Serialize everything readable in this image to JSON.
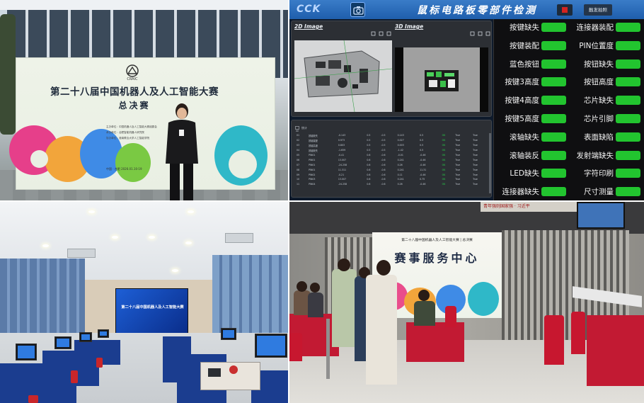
{
  "banner": {
    "brand": "CRAIC",
    "title_line1": "第二十八届中国机器人及人工智能大赛",
    "title_line2": "总决赛",
    "date": "中国 · 合肥    2026.01.10-19",
    "organizers": [
      "主办单位：中国机器人及人工智能大赛组委会",
      "承办单位：合肥智能机器人研究院",
      "协办单位：淮南联合大学人工智能学院"
    ]
  },
  "software": {
    "brand": "CCK",
    "title": "鼠标电路板零部件检测",
    "trigger_button": "触发拍照",
    "panel_2d": "2D Image",
    "panel_3d": "3D Image",
    "table_title": "统计",
    "table_tab": "All",
    "table_rows": [
      [
        "01",
        "按键缺失",
        "-0.143",
        "0.5",
        "-0.5",
        "0.143",
        "0.5",
        "OK",
        "True",
        "True"
      ],
      [
        "02",
        "按键装配",
        "0.973",
        "0.5",
        "-0.5",
        "0.027",
        "0.5",
        "OK",
        "True",
        "True"
      ],
      [
        "03",
        "按键高度",
        "0.803",
        "0.5",
        "-0.5",
        "0.003",
        "0.5",
        "OK",
        "True",
        "True"
      ],
      [
        "04",
        "按键缺失",
        "-1.659",
        "0.5",
        "-0.5",
        "-1.42",
        "0.5",
        "OK",
        "True",
        "True"
      ],
      [
        "05",
        "PIN01",
        "-0.41",
        "0.6",
        "-0.6",
        "-0.01",
        "-0.46",
        "OK",
        "True",
        "True"
      ],
      [
        "06",
        "PIN01",
        "13.007",
        "0.6",
        "-0.6",
        "0.241",
        "-0.46",
        "OK",
        "True",
        "True"
      ],
      [
        "07",
        "PIN01",
        "-24.258",
        "0.6",
        "-0.6",
        "0.26",
        "-0.46",
        "OK",
        "True",
        "True"
      ],
      [
        "08",
        "PIN01",
        "11.311",
        "0.6",
        "-0.6",
        "0.241",
        "11.31",
        "OK",
        "True",
        "True"
      ],
      [
        "09",
        "PIN02",
        "-0.21",
        "0.6",
        "-0.6",
        "0.11",
        "-0.46",
        "OK",
        "True",
        "True"
      ],
      [
        "10",
        "PIN03",
        "13.007",
        "0.6",
        "-0.6",
        "0.241",
        "0.75",
        "OK",
        "True",
        "True"
      ],
      [
        "11",
        "PIN04",
        "-24.258",
        "0.6",
        "-0.6",
        "0.26",
        "-0.46",
        "OK",
        "True",
        "True"
      ]
    ],
    "checks_left": [
      "按键缺失",
      "按键装配",
      "蓝色按钮",
      "按键3高度",
      "按键4高度",
      "按键5高度",
      "滚轴缺失",
      "滚轴装反",
      "LED缺失",
      "连接器缺失"
    ],
    "checks_right": [
      "连接器装配",
      "PIN位置度",
      "按钮缺失",
      "按钮高度",
      "芯片缺失",
      "芯片引脚",
      "表面缺陷",
      "发射端缺失",
      "字符印刷",
      "尺寸测量"
    ],
    "ok_color": "#22c42f"
  },
  "hall": {
    "screen_text": "第二十八届中国机器人及人工智能大赛"
  },
  "service": {
    "led_small": "第二十八届中国机器人及人工智能大赛 | 总决赛",
    "led_big": "赛事服务中心",
    "wall_slogan": "青年强则国家强 · 习近平"
  }
}
